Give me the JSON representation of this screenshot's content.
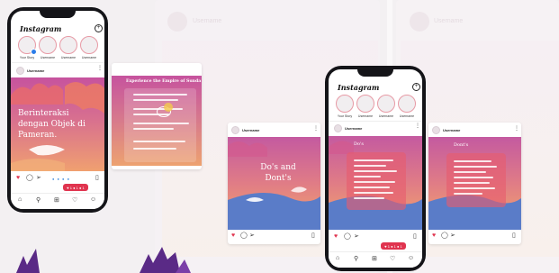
{
  "left_phone": {
    "app_logo": "Instagram",
    "stories": [
      {
        "label": "Your Story"
      },
      {
        "label": "Username"
      },
      {
        "label": "Username"
      },
      {
        "label": "Username"
      }
    ],
    "post": {
      "username": "Username",
      "headline": "Berinteraksi dengan Objek di Pameran."
    }
  },
  "left_card": {
    "title": "Experience the Empire of Sunda"
  },
  "center_card": {
    "username": "Username",
    "headline": "Do's and Dont's"
  },
  "right_phone": {
    "app_logo": "Instagram",
    "stories": [
      {
        "label": "Your Story"
      },
      {
        "label": "Username"
      },
      {
        "label": "Username"
      },
      {
        "label": "Username"
      }
    ],
    "post": {
      "username": "Username",
      "title": "Do's"
    }
  },
  "right_card": {
    "username": "Username",
    "title": "Dont's"
  },
  "background": {
    "ghost_username_1": "Username",
    "ghost_username_2": "Username"
  },
  "colors": {
    "accent": "#e0344f",
    "phone_body": "#141418",
    "sky_top": "#c45aa0",
    "sky_bottom": "#f3a86a",
    "mountain": "#5a7cc8"
  },
  "icons": [
    "heart-icon",
    "comment-icon",
    "share-icon",
    "bookmark-icon",
    "home-icon",
    "search-icon",
    "add-post-icon",
    "like-icon",
    "profile-icon",
    "plus-circle-icon"
  ]
}
